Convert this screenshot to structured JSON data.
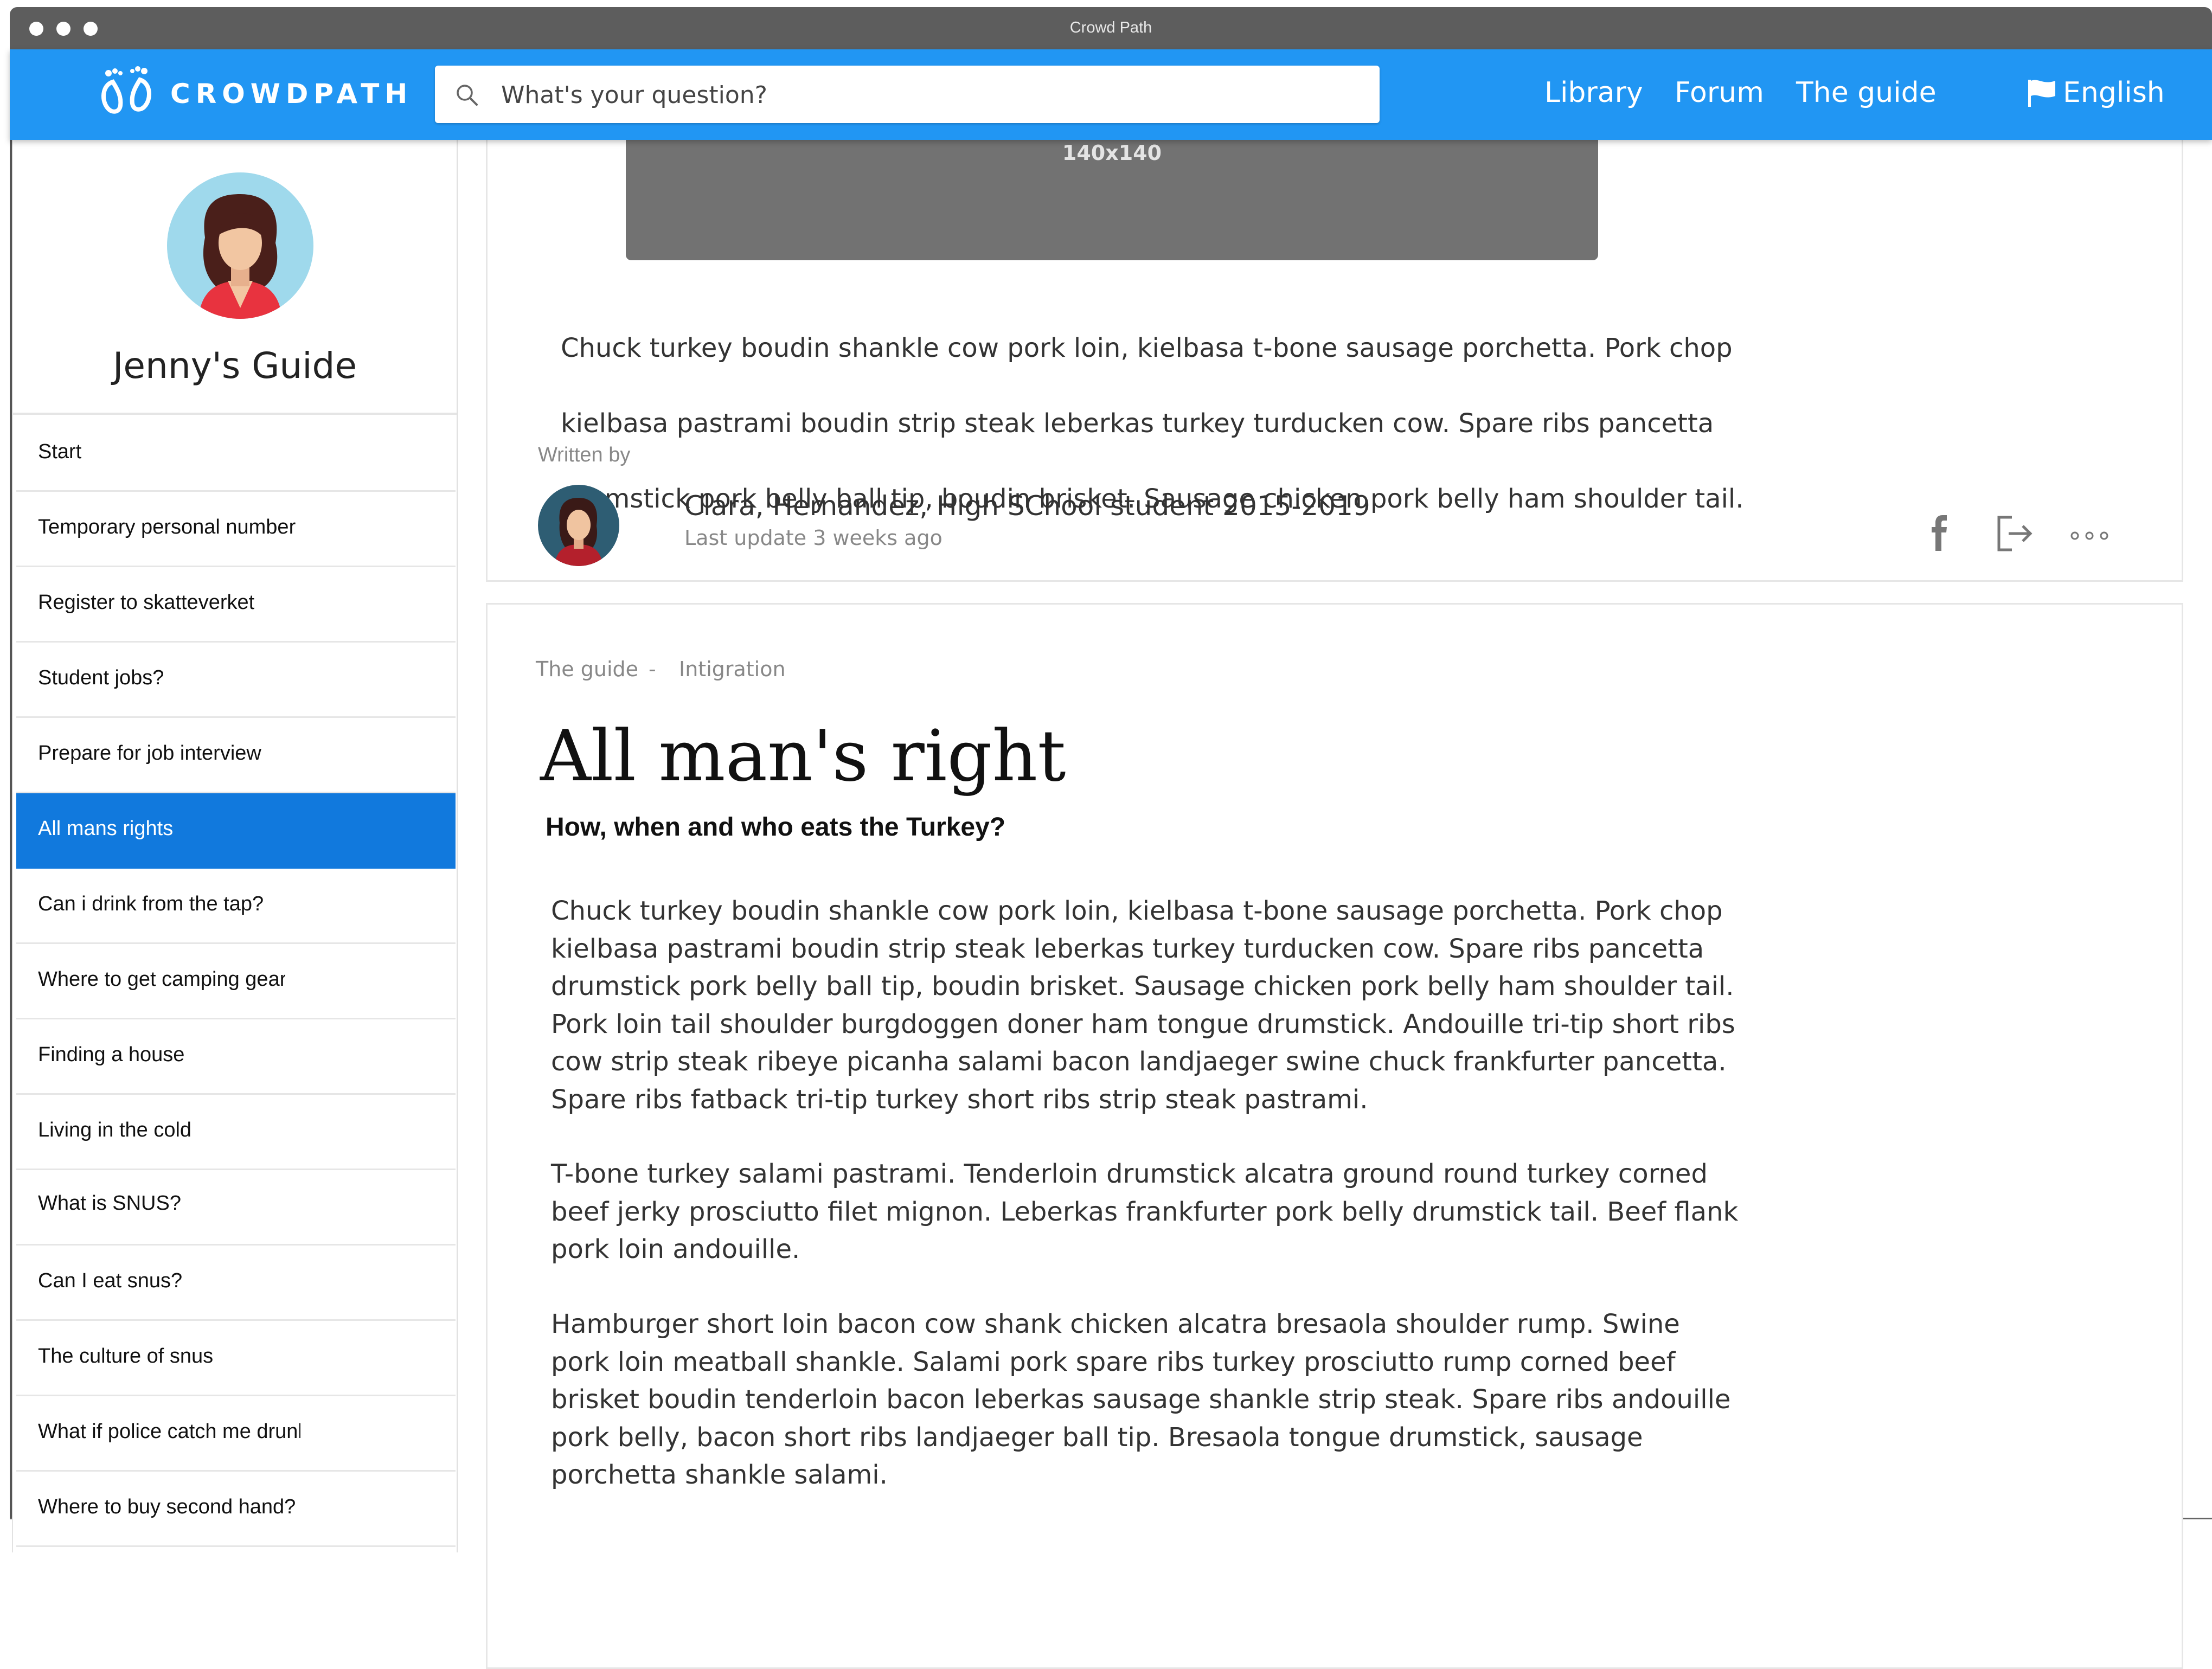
{
  "window": {
    "title": "Crowd Path"
  },
  "header": {
    "brand": "CROWDPATH",
    "search_placeholder": "What's your question?",
    "nav": [
      "Library",
      "Forum",
      "The guide"
    ],
    "language": "English"
  },
  "sidebar": {
    "title": "Jenny's Guide",
    "items": [
      {
        "label": "Start"
      },
      {
        "label": "Temporary personal number"
      },
      {
        "label": "Register to skatteverket"
      },
      {
        "label": "Student jobs?"
      },
      {
        "label": "Prepare for job interview"
      },
      {
        "label": "All mans rights",
        "active": true
      },
      {
        "label": "Can i drink from the tap?"
      },
      {
        "label": "Where to get camping gear"
      },
      {
        "label": "Finding a house"
      },
      {
        "label": "Living in the cold"
      },
      {
        "label": "What is SNUS?"
      },
      {
        "label": "Can I eat snus?"
      },
      {
        "label": "The culture of snus"
      },
      {
        "label": "What if police catch me drunk"
      },
      {
        "label": "Where to buy second hand?"
      }
    ]
  },
  "previous_article": {
    "image_label": "140x140",
    "text_lines": [
      "Chuck turkey boudin shankle cow pork loin, kielbasa t-bone sausage porchetta. Pork chop",
      "kielbasa pastrami boudin strip steak leberkas turkey turducken cow. Spare ribs pancetta",
      "drumstick pork belly ball tip, boudin brisket. Sausage chicken pork belly ham shoulder tail."
    ],
    "written_by_label": "Written by",
    "author": "Clara, Hernandez, High SChool student 2015-2019",
    "last_update": "Last update 3 weeks ago"
  },
  "article": {
    "breadcrumb": [
      "The guide",
      "-",
      "Intigration"
    ],
    "title": "All man's right",
    "subtitle": "How, when and who eats the Turkey?",
    "paragraphs": [
      [
        "Chuck turkey boudin shankle cow pork loin, kielbasa t-bone sausage porchetta. Pork chop",
        "kielbasa pastrami boudin strip steak leberkas turkey turducken cow. Spare ribs pancetta",
        "drumstick pork belly ball tip, boudin brisket. Sausage chicken pork belly ham shoulder tail.",
        "Pork loin tail shoulder burgdoggen doner ham tongue drumstick. Andouille tri-tip short ribs",
        "cow strip steak ribeye picanha salami bacon landjaeger swine chuck frankfurter pancetta.",
        "Spare ribs fatback tri-tip turkey short ribs strip steak pastrami."
      ],
      [
        "T-bone turkey salami pastrami. Tenderloin drumstick alcatra ground round turkey corned",
        "beef jerky prosciutto filet mignon. Leberkas frankfurter pork belly drumstick tail. Beef flank",
        "pork loin andouille."
      ],
      [
        "Hamburger short loin bacon cow shank chicken alcatra bresaola shoulder rump. Swine",
        "pork loin meatball shankle. Salami pork spare ribs turkey prosciutto rump corned beef",
        "brisket boudin tenderloin bacon leberkas sausage shankle strip steak. Spare ribs andouille",
        "pork belly, bacon short ribs landjaeger ball tip. Bresaola tongue drumstick, sausage",
        "porchetta shankle salami."
      ]
    ]
  },
  "colors": {
    "header": "#2196f3",
    "active_item": "#1179dd",
    "titlebar": "#5d5d5d"
  },
  "icons": [
    "footprints-logo-icon",
    "search-icon",
    "flag-icon",
    "facebook-icon",
    "share-icon",
    "more-icon"
  ]
}
